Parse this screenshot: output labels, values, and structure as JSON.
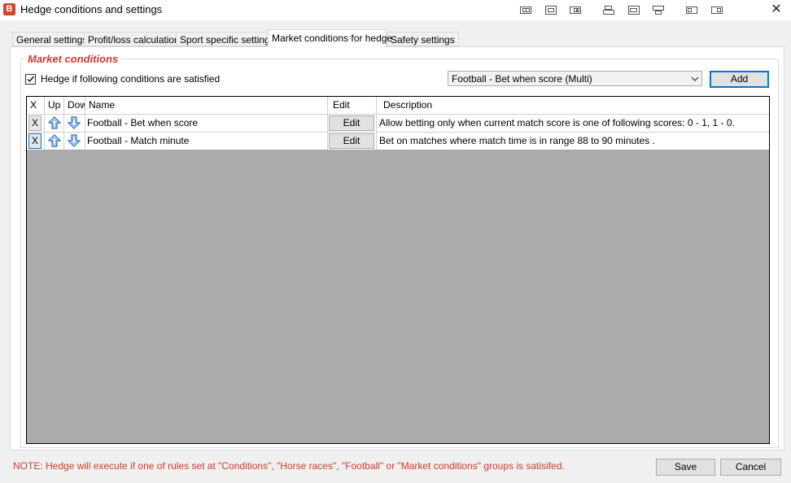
{
  "window": {
    "title": "Hedge conditions and settings",
    "close_glyph": "✕"
  },
  "tabs": [
    {
      "label": "General settings",
      "active": false
    },
    {
      "label": "Profit/loss calculation",
      "active": false
    },
    {
      "label": "Sport specific settings",
      "active": false
    },
    {
      "label": "Market conditions for hedge",
      "active": true
    },
    {
      "label": "Safety settings",
      "active": false
    }
  ],
  "market_conditions": {
    "group_title": "Market conditions",
    "checkbox_label": "Hedge if following conditions are satisfied",
    "checkbox_checked": true,
    "condition_select_value": "Football - Bet when score (Multi)",
    "add_label": "Add"
  },
  "grid": {
    "headers": {
      "x": "X",
      "up": "Up",
      "down": "Dow",
      "name": "Name",
      "edit": "Edit",
      "description": "Description"
    },
    "rows": [
      {
        "x": "X",
        "name": "Football - Bet when score",
        "edit": "Edit",
        "description": "Allow betting only when current match score is one of following scores: 0 - 1, 1 - 0."
      },
      {
        "x": "X",
        "name": "Football - Match minute",
        "edit": "Edit",
        "description": "Bet on matches where match time is in range 88 to 90 minutes ."
      }
    ]
  },
  "footer": {
    "note": "NOTE: Hedge will execute if one of rules set at \"Conditions\", \"Horse races\", \"Football\" or \"Market conditions\" groups is satisifed.",
    "save_label": "Save",
    "cancel_label": "Cancel"
  },
  "colors": {
    "accent_red": "#d13b2c",
    "focus_blue": "#0078d7",
    "grid_background": "#ababab"
  }
}
